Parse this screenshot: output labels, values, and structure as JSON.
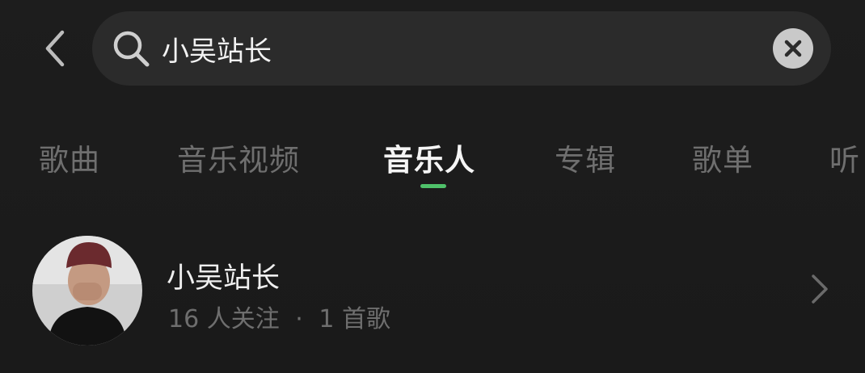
{
  "search": {
    "value": "小吴站长"
  },
  "tabs": [
    {
      "label": "歌曲",
      "active": false
    },
    {
      "label": "音乐视频",
      "active": false
    },
    {
      "label": "音乐人",
      "active": true
    },
    {
      "label": "专辑",
      "active": false
    },
    {
      "label": "歌单",
      "active": false
    },
    {
      "label": "听",
      "active": false
    }
  ],
  "result": {
    "name": "小吴站长",
    "followers": "16 人关注",
    "separator": "·",
    "songs": "1 首歌"
  },
  "icons": {
    "back": "back-chevron-icon",
    "search": "search-icon",
    "clear": "clear-icon",
    "row_arrow": "chevron-right-icon"
  },
  "colors": {
    "background": "#1a1a1a",
    "search_bg": "#2b2b2b",
    "tab_indicator": "#4fc16a",
    "active_tab": "#f5f5f5",
    "inactive_tab": "#6f6f6f"
  }
}
